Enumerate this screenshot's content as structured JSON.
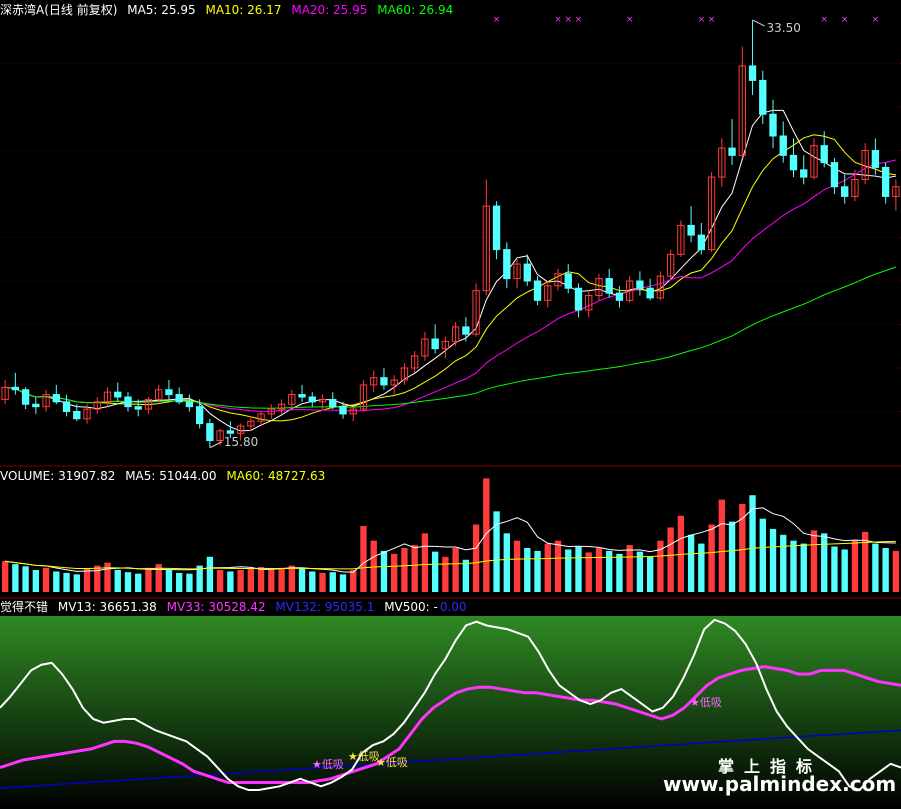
{
  "header_main": {
    "name": "深赤湾A",
    "period": "(日线 前复权)",
    "ma5": "MA5: 25.95",
    "ma10": "MA10: 26.17",
    "ma20": "MA20: 25.95",
    "ma60": "MA60: 26.94"
  },
  "header_volume": {
    "volume": "VOLUME: 31907.82",
    "ma5": "MA5: 51044.00",
    "ma60": "MA60: 48727.63"
  },
  "header_indicator": {
    "name": "觉得不错",
    "mv13": "MV13: 36651.38",
    "mv33": "MV33: 30528.42",
    "mv132": "MV132: 95035.1",
    "mv500": "MV500: -",
    "mv500_value": "0.00"
  },
  "watermark": {
    "cn": "掌上指标",
    "url": "www.palmindex.com"
  },
  "colors": {
    "up": "#ff3b3b",
    "down": "#54ffff",
    "ma5": "#ffffff",
    "ma10": "#ffff00",
    "ma20": "#ff00ff",
    "ma60": "#00ff00",
    "mv13": "#ffffff",
    "mv33": "#ff33ff",
    "mv132": "#0000cc"
  },
  "chart_data": {
    "type": "candlestick",
    "high_label": "33.50",
    "low_label": "15.80",
    "price_range": [
      15.5,
      33.5
    ],
    "candles_ohlc": [
      [
        17.8,
        18.6,
        17.6,
        18.3
      ],
      [
        18.3,
        18.9,
        18.0,
        18.2
      ],
      [
        18.2,
        18.3,
        17.4,
        17.6
      ],
      [
        17.6,
        17.9,
        17.2,
        17.5
      ],
      [
        17.5,
        18.2,
        17.3,
        18.0
      ],
      [
        18.0,
        18.4,
        17.6,
        17.7
      ],
      [
        17.7,
        18.0,
        17.1,
        17.3
      ],
      [
        17.3,
        17.6,
        16.9,
        17.0
      ],
      [
        17.0,
        17.6,
        16.8,
        17.4
      ],
      [
        17.4,
        17.9,
        17.2,
        17.7
      ],
      [
        17.7,
        18.3,
        17.5,
        18.1
      ],
      [
        18.1,
        18.5,
        17.7,
        17.9
      ],
      [
        17.9,
        18.1,
        17.3,
        17.5
      ],
      [
        17.5,
        17.8,
        17.1,
        17.4
      ],
      [
        17.4,
        17.9,
        17.2,
        17.8
      ],
      [
        17.8,
        18.4,
        17.6,
        18.2
      ],
      [
        18.2,
        18.6,
        17.8,
        18.0
      ],
      [
        18.0,
        18.3,
        17.6,
        17.7
      ],
      [
        17.7,
        18.0,
        17.3,
        17.5
      ],
      [
        17.5,
        17.8,
        16.6,
        16.8
      ],
      [
        16.8,
        17.0,
        15.8,
        16.1
      ],
      [
        16.1,
        16.6,
        15.9,
        16.5
      ],
      [
        16.5,
        16.9,
        16.2,
        16.4
      ],
      [
        16.4,
        16.8,
        16.1,
        16.7
      ],
      [
        16.7,
        17.1,
        16.5,
        16.9
      ],
      [
        16.9,
        17.3,
        16.7,
        17.2
      ],
      [
        17.2,
        17.6,
        17.0,
        17.4
      ],
      [
        17.4,
        17.8,
        17.2,
        17.6
      ],
      [
        17.6,
        18.2,
        17.4,
        18.0
      ],
      [
        18.0,
        18.4,
        17.7,
        17.9
      ],
      [
        17.9,
        18.1,
        17.5,
        17.7
      ],
      [
        17.7,
        18.0,
        17.4,
        17.8
      ],
      [
        17.8,
        18.1,
        17.4,
        17.5
      ],
      [
        17.5,
        17.7,
        17.0,
        17.2
      ],
      [
        17.2,
        17.5,
        16.9,
        17.4
      ],
      [
        17.4,
        18.6,
        17.3,
        18.4
      ],
      [
        18.4,
        19.0,
        18.1,
        18.7
      ],
      [
        18.7,
        19.1,
        18.2,
        18.4
      ],
      [
        18.4,
        18.8,
        18.0,
        18.6
      ],
      [
        18.6,
        19.3,
        18.4,
        19.1
      ],
      [
        19.1,
        19.8,
        18.9,
        19.6
      ],
      [
        19.6,
        20.6,
        19.4,
        20.3
      ],
      [
        20.3,
        20.9,
        19.7,
        19.9
      ],
      [
        19.9,
        20.4,
        19.5,
        20.2
      ],
      [
        20.2,
        21.0,
        20.0,
        20.8
      ],
      [
        20.8,
        21.2,
        20.2,
        20.5
      ],
      [
        20.5,
        22.6,
        20.4,
        22.3
      ],
      [
        22.3,
        26.9,
        22.1,
        25.8
      ],
      [
        25.8,
        26.0,
        23.6,
        24.0
      ],
      [
        24.0,
        24.3,
        22.4,
        22.8
      ],
      [
        22.8,
        23.6,
        22.4,
        23.4
      ],
      [
        23.4,
        23.8,
        22.5,
        22.7
      ],
      [
        22.7,
        22.9,
        21.7,
        21.9
      ],
      [
        21.9,
        22.7,
        21.6,
        22.5
      ],
      [
        22.5,
        23.2,
        22.3,
        23.0
      ],
      [
        23.0,
        23.4,
        22.2,
        22.4
      ],
      [
        22.4,
        22.6,
        21.2,
        21.5
      ],
      [
        21.5,
        22.3,
        21.2,
        22.1
      ],
      [
        22.1,
        23.0,
        21.9,
        22.8
      ],
      [
        22.8,
        23.2,
        22.0,
        22.2
      ],
      [
        22.2,
        22.5,
        21.6,
        21.9
      ],
      [
        21.9,
        22.9,
        21.8,
        22.7
      ],
      [
        22.7,
        23.1,
        22.1,
        22.4
      ],
      [
        22.4,
        22.8,
        21.9,
        22.0
      ],
      [
        22.0,
        23.1,
        21.9,
        22.9
      ],
      [
        22.9,
        24.0,
        22.8,
        23.8
      ],
      [
        23.8,
        25.2,
        23.7,
        25.0
      ],
      [
        25.0,
        25.8,
        24.3,
        24.6
      ],
      [
        24.6,
        25.1,
        23.8,
        24.0
      ],
      [
        24.0,
        27.2,
        23.9,
        27.0
      ],
      [
        27.0,
        28.6,
        26.6,
        28.2
      ],
      [
        28.2,
        29.4,
        27.5,
        27.9
      ],
      [
        27.9,
        32.4,
        27.8,
        31.6
      ],
      [
        31.6,
        33.5,
        30.4,
        31.0
      ],
      [
        31.0,
        31.4,
        29.2,
        29.6
      ],
      [
        29.6,
        30.2,
        28.2,
        28.7
      ],
      [
        28.7,
        29.3,
        27.6,
        27.9
      ],
      [
        27.9,
        28.6,
        27.0,
        27.3
      ],
      [
        27.3,
        27.9,
        26.7,
        27.0
      ],
      [
        27.0,
        28.6,
        26.9,
        28.3
      ],
      [
        28.3,
        28.9,
        27.4,
        27.6
      ],
      [
        27.6,
        27.8,
        26.3,
        26.6
      ],
      [
        26.6,
        27.1,
        25.9,
        26.2
      ],
      [
        26.2,
        27.3,
        26.0,
        26.9
      ],
      [
        26.9,
        28.4,
        26.7,
        28.1
      ],
      [
        28.1,
        28.6,
        27.1,
        27.4
      ],
      [
        27.4,
        27.6,
        25.9,
        26.2
      ],
      [
        26.2,
        26.9,
        25.6,
        26.6
      ]
    ],
    "volume_range": [
      0,
      150000
    ],
    "volume_bars": [
      42,
      38,
      35,
      30,
      33,
      28,
      26,
      24,
      32,
      36,
      40,
      30,
      27,
      25,
      33,
      38,
      30,
      26,
      25,
      36,
      48,
      30,
      28,
      30,
      32,
      34,
      30,
      33,
      36,
      32,
      28,
      26,
      27,
      24,
      30,
      90,
      70,
      56,
      52,
      60,
      64,
      80,
      55,
      48,
      60,
      44,
      92,
      155,
      110,
      80,
      70,
      60,
      56,
      66,
      70,
      58,
      62,
      54,
      60,
      56,
      52,
      64,
      55,
      48,
      70,
      88,
      104,
      78,
      66,
      92,
      126,
      96,
      120,
      132,
      100,
      86,
      78,
      70,
      66,
      84,
      80,
      62,
      58,
      70,
      82,
      66,
      60,
      56
    ],
    "volume_up": [
      true,
      false,
      false,
      false,
      true,
      false,
      false,
      false,
      true,
      true,
      true,
      false,
      false,
      false,
      true,
      true,
      false,
      false,
      false,
      false,
      false,
      true,
      false,
      true,
      true,
      true,
      true,
      true,
      true,
      false,
      false,
      true,
      false,
      false,
      true,
      true,
      true,
      false,
      true,
      true,
      true,
      true,
      false,
      true,
      true,
      false,
      true,
      true,
      false,
      false,
      true,
      false,
      false,
      true,
      true,
      false,
      false,
      true,
      true,
      false,
      false,
      true,
      false,
      false,
      true,
      true,
      true,
      false,
      false,
      true,
      true,
      false,
      true,
      false,
      false,
      false,
      false,
      false,
      false,
      true,
      false,
      false,
      false,
      true,
      true,
      false,
      false,
      true
    ],
    "indicator_range": [
      0,
      100
    ],
    "mv13": [
      52,
      58,
      65,
      72,
      75,
      76,
      70,
      62,
      52,
      46,
      44,
      45,
      46,
      46,
      43,
      40,
      38,
      36,
      34,
      30,
      26,
      20,
      14,
      10,
      8,
      8,
      9,
      10,
      12,
      14,
      12,
      10,
      12,
      15,
      19,
      28,
      32,
      34,
      38,
      44,
      52,
      60,
      70,
      78,
      88,
      96,
      98,
      96,
      95,
      94,
      92,
      90,
      82,
      72,
      64,
      60,
      56,
      54,
      56,
      60,
      62,
      58,
      54,
      50,
      52,
      58,
      68,
      80,
      94,
      99,
      97,
      93,
      86,
      76,
      62,
      50,
      42,
      36,
      30,
      26,
      22,
      18,
      10,
      8,
      14,
      18,
      22,
      20
    ],
    "mv33": [
      20,
      22,
      24,
      25,
      26,
      27,
      28,
      29,
      30,
      32,
      34,
      34,
      33,
      31,
      28,
      25,
      22,
      18,
      16,
      14,
      12,
      12,
      12,
      12,
      12,
      12,
      12,
      12,
      13,
      14,
      16,
      18,
      20,
      22,
      26,
      30,
      38,
      46,
      52,
      56,
      60,
      62,
      63,
      63,
      62,
      61,
      60,
      60,
      59,
      58,
      57,
      56,
      56,
      55,
      54,
      52,
      50,
      48,
      46,
      48,
      52,
      58,
      64,
      68,
      70,
      72,
      73,
      74,
      73,
      72,
      70,
      70,
      72,
      72,
      72,
      70,
      68,
      66,
      65,
      64
    ],
    "mv132": [
      9,
      10,
      11,
      12,
      13,
      14,
      15,
      16,
      17,
      18,
      19,
      20,
      21,
      22,
      23,
      24,
      25,
      26,
      27,
      28,
      29,
      30,
      31,
      32,
      33,
      34,
      35,
      36,
      37,
      38,
      39,
      40
    ],
    "signal_labels": [
      "低吸",
      "低吸",
      "低吸",
      "低吸"
    ]
  }
}
